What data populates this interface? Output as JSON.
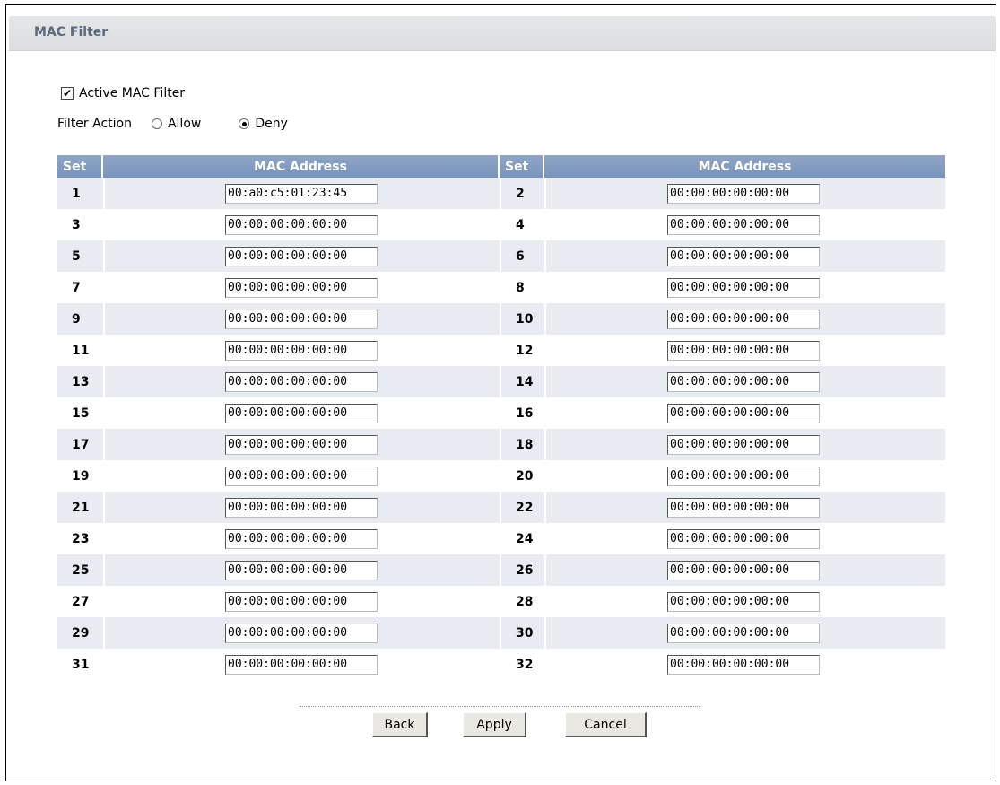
{
  "page": {
    "title": "MAC Filter"
  },
  "active_filter": {
    "label": "Active MAC Filter",
    "checked": true
  },
  "filter_action": {
    "label": "Filter Action",
    "options": [
      {
        "label": "Allow",
        "selected": false
      },
      {
        "label": "Deny",
        "selected": true
      }
    ]
  },
  "table": {
    "headers": {
      "set": "Set",
      "mac": "MAC Address"
    },
    "rows": [
      {
        "left_set": "1",
        "left_mac": "00:a0:c5:01:23:45",
        "right_set": "2",
        "right_mac": "00:00:00:00:00:00"
      },
      {
        "left_set": "3",
        "left_mac": "00:00:00:00:00:00",
        "right_set": "4",
        "right_mac": "00:00:00:00:00:00"
      },
      {
        "left_set": "5",
        "left_mac": "00:00:00:00:00:00",
        "right_set": "6",
        "right_mac": "00:00:00:00:00:00"
      },
      {
        "left_set": "7",
        "left_mac": "00:00:00:00:00:00",
        "right_set": "8",
        "right_mac": "00:00:00:00:00:00"
      },
      {
        "left_set": "9",
        "left_mac": "00:00:00:00:00:00",
        "right_set": "10",
        "right_mac": "00:00:00:00:00:00"
      },
      {
        "left_set": "11",
        "left_mac": "00:00:00:00:00:00",
        "right_set": "12",
        "right_mac": "00:00:00:00:00:00"
      },
      {
        "left_set": "13",
        "left_mac": "00:00:00:00:00:00",
        "right_set": "14",
        "right_mac": "00:00:00:00:00:00"
      },
      {
        "left_set": "15",
        "left_mac": "00:00:00:00:00:00",
        "right_set": "16",
        "right_mac": "00:00:00:00:00:00"
      },
      {
        "left_set": "17",
        "left_mac": "00:00:00:00:00:00",
        "right_set": "18",
        "right_mac": "00:00:00:00:00:00"
      },
      {
        "left_set": "19",
        "left_mac": "00:00:00:00:00:00",
        "right_set": "20",
        "right_mac": "00:00:00:00:00:00"
      },
      {
        "left_set": "21",
        "left_mac": "00:00:00:00:00:00",
        "right_set": "22",
        "right_mac": "00:00:00:00:00:00"
      },
      {
        "left_set": "23",
        "left_mac": "00:00:00:00:00:00",
        "right_set": "24",
        "right_mac": "00:00:00:00:00:00"
      },
      {
        "left_set": "25",
        "left_mac": "00:00:00:00:00:00",
        "right_set": "26",
        "right_mac": "00:00:00:00:00:00"
      },
      {
        "left_set": "27",
        "left_mac": "00:00:00:00:00:00",
        "right_set": "28",
        "right_mac": "00:00:00:00:00:00"
      },
      {
        "left_set": "29",
        "left_mac": "00:00:00:00:00:00",
        "right_set": "30",
        "right_mac": "00:00:00:00:00:00"
      },
      {
        "left_set": "31",
        "left_mac": "00:00:00:00:00:00",
        "right_set": "32",
        "right_mac": "00:00:00:00:00:00"
      }
    ]
  },
  "buttons": {
    "back": "Back",
    "apply": "Apply",
    "cancel": "Cancel"
  },
  "colors": {
    "header_bg": "#7f98c0",
    "alt_row_bg": "#e8ebf2",
    "title_bar_bg": "#e0e2e4",
    "title_text": "#5b6a7f"
  }
}
